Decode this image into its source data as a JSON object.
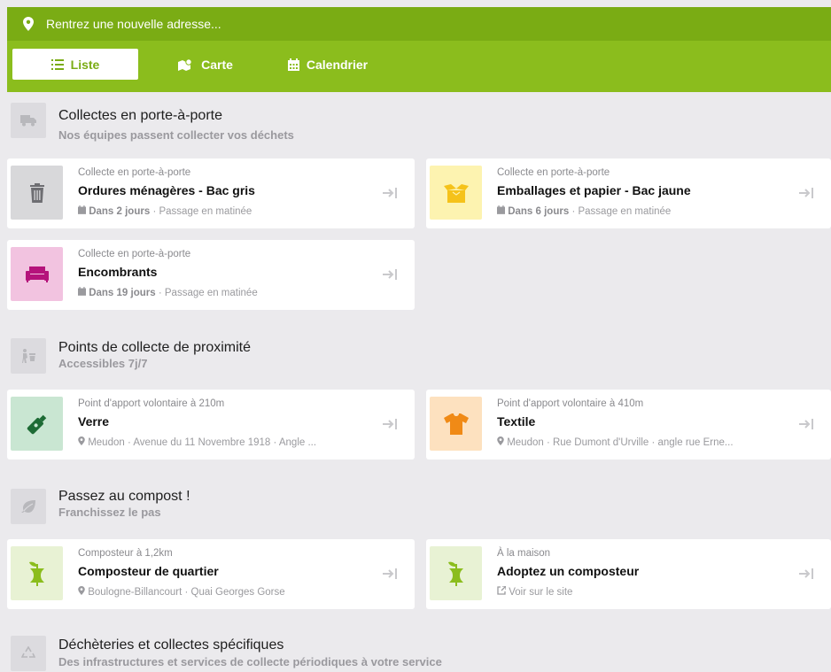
{
  "search": {
    "placeholder": "Rentrez une nouvelle adresse..."
  },
  "tabs": [
    {
      "label": "Liste",
      "active": true
    },
    {
      "label": "Carte",
      "active": false
    },
    {
      "label": "Calendrier",
      "active": false
    }
  ],
  "colors": {
    "brand_green": "#8bbd1d",
    "brand_green_dark": "#7aac14"
  },
  "sections": [
    {
      "icon": "truck-icon",
      "title": "Collectes en porte-à-porte",
      "subtitle": "Nos équipes passent collecter vos déchets",
      "cards": [
        {
          "type": "Collecte en porte-à-porte",
          "title": "Ordures ménagères - Bac gris",
          "icon": "trash-bin-icon",
          "thumb_color": "#d8d8da",
          "when": "Dans 2 jours",
          "sep": "·",
          "detail": "Passage en matinée"
        },
        {
          "type": "Collecte en porte-à-porte",
          "title": "Emballages et papier - Bac jaune",
          "icon": "open-box-icon",
          "thumb_color": "#fdf3b0",
          "when": "Dans 6 jours",
          "sep": "·",
          "detail": "Passage en matinée"
        },
        {
          "type": "Collecte en porte-à-porte",
          "title": "Encombrants",
          "icon": "sofa-icon",
          "thumb_color": "#f2c3e0",
          "when": "Dans 19 jours",
          "sep": "·",
          "detail": "Passage en matinée"
        }
      ]
    },
    {
      "icon": "person-bin-icon",
      "title": "Points de collecte de proximité",
      "subtitle": "Accessibles 7j/7",
      "cards": [
        {
          "type": "Point d'apport volontaire à 210m",
          "title": "Verre",
          "icon": "bottle-icon",
          "thumb_color": "#c9e6d2",
          "meta": "Meudon · Avenue du 11 Novembre 1918 · Angle ..."
        },
        {
          "type": "Point d'apport volontaire à 410m",
          "title": "Textile",
          "icon": "tshirt-icon",
          "thumb_color": "#fde1bf",
          "meta": "Meudon · Rue Dumont d'Urville · angle rue Erne..."
        }
      ]
    },
    {
      "icon": "leaf-icon",
      "title": "Passez au compost !",
      "subtitle": "Franchissez le pas",
      "cards": [
        {
          "type": "Composteur à 1,2km",
          "title": "Composteur de quartier",
          "icon": "apple-core-icon",
          "thumb_color": "#e8f2d4",
          "meta": "Boulogne-Billancourt · Quai Georges Gorse"
        },
        {
          "type": "À la maison",
          "title": "Adoptez un composteur",
          "icon": "apple-core-icon",
          "thumb_color": "#e8f2d4",
          "link": "Voir sur le site"
        }
      ]
    },
    {
      "icon": "recycle-icon",
      "title": "Déchèteries et collectes spécifiques",
      "subtitle": "Des infrastructures et services de collecte périodiques à votre service"
    }
  ]
}
